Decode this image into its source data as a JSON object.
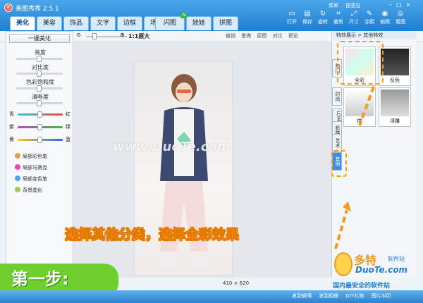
{
  "app": {
    "title": "美图秀秀 2.5.1",
    "top_links": [
      "菜单",
      "提意见"
    ],
    "window_controls": [
      "minimize-icon",
      "maximize-icon",
      "close-icon"
    ]
  },
  "tabs": [
    {
      "label": "美化",
      "active": true
    },
    {
      "label": "美容"
    },
    {
      "label": "饰品"
    },
    {
      "label": "文字"
    },
    {
      "label": "边框"
    },
    {
      "label": "场景"
    },
    {
      "label": "闪图",
      "badge": "N"
    },
    {
      "label": "娃娃"
    },
    {
      "label": "拼图"
    }
  ],
  "tools": [
    {
      "label": "打开",
      "icon": "open-icon"
    },
    {
      "label": "保存",
      "icon": "save-icon"
    },
    {
      "label": "旋转",
      "icon": "rotate-icon"
    },
    {
      "label": "裁剪",
      "icon": "crop-icon"
    },
    {
      "label": "尺寸",
      "icon": "resize-icon"
    },
    {
      "label": "涂鸦",
      "icon": "brush-icon"
    },
    {
      "label": "拍照",
      "icon": "camera-icon"
    },
    {
      "label": "看图",
      "icon": "view-icon"
    }
  ],
  "left": {
    "one_key": "一键美化",
    "adjustments": [
      {
        "label": "亮度",
        "value": 0.5
      },
      {
        "label": "对比度",
        "value": 0.5
      },
      {
        "label": "色彩饱和度",
        "value": 0.5
      },
      {
        "label": "清晰度",
        "value": 0.5
      }
    ],
    "colors": [
      {
        "left": "青",
        "right": "红"
      },
      {
        "left": "紫",
        "right": "绿"
      },
      {
        "left": "黄",
        "right": "蓝"
      }
    ],
    "brushes": [
      "局部彩色笔",
      "局部马赛克",
      "局部变色笔",
      "背景虚化"
    ]
  },
  "zoom": {
    "label": "1:1原大"
  },
  "undo_bar": [
    "撤销",
    "重做",
    "原图",
    "对比",
    "预览"
  ],
  "right": {
    "header": "特效展示 > 其他特效",
    "vertical_tabs": [
      "热门",
      "时尚",
      "LOMO",
      "影楼",
      "艺术",
      "其他"
    ],
    "effects": [
      {
        "label": "全彩"
      },
      {
        "label": "反色"
      },
      {
        "label": "描"
      },
      {
        "label": "浮雕"
      }
    ]
  },
  "photo": {
    "size": "410 × 620",
    "watermark": "www.DuoTe.com"
  },
  "caption": "选择其他分类，选择全彩效果",
  "step": "第一步:",
  "status": [
    "发到微博",
    "发到相册",
    "DIY礼物",
    "图片冲印"
  ],
  "site": {
    "name": "多特",
    "sub": "软件站",
    "url": "DuoTe.com",
    "slogan": "国内最安全的软件站"
  }
}
